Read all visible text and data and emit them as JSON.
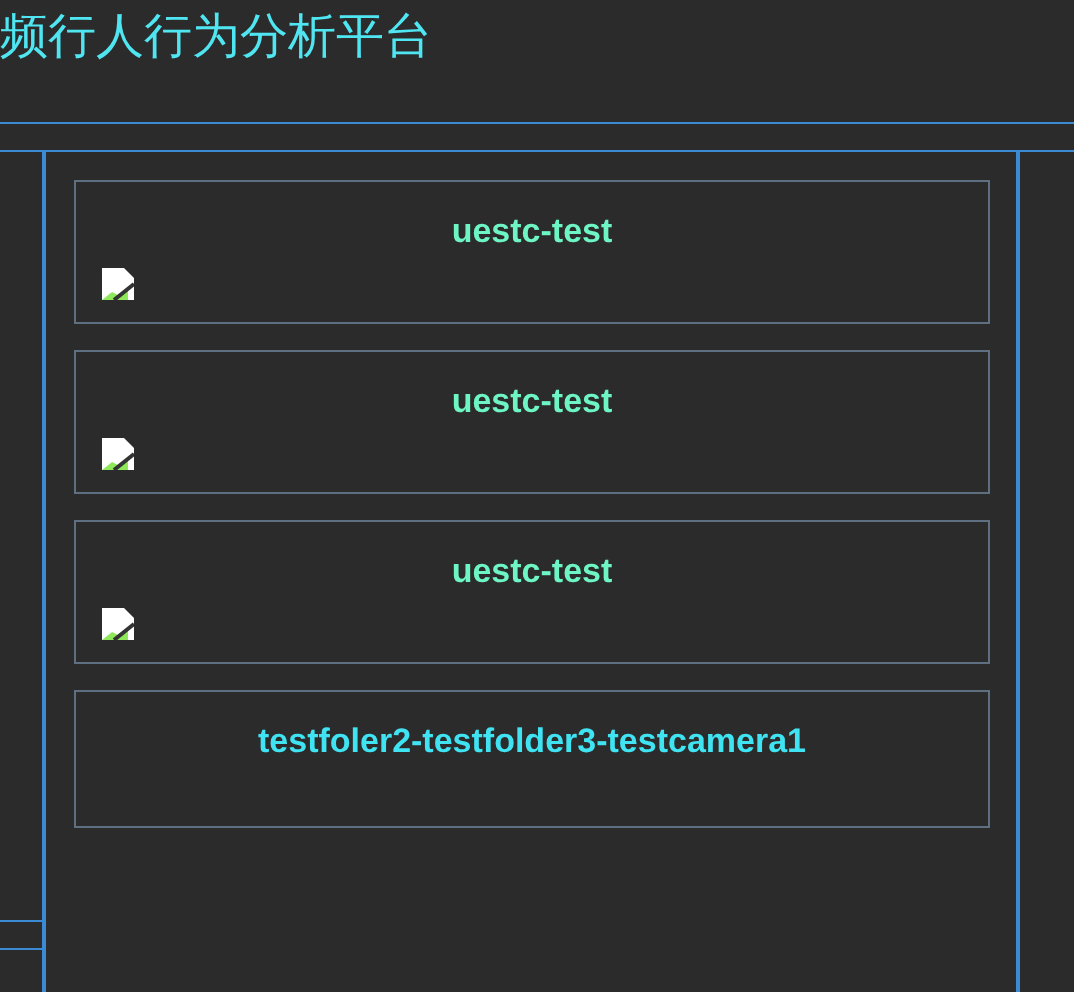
{
  "header": {
    "title": "频行人行为分析平台"
  },
  "cards": [
    {
      "kind": "camera",
      "title": "uestc-test",
      "color": "#6ef5c4"
    },
    {
      "kind": "camera",
      "title": "uestc-test",
      "color": "#6ef5c4"
    },
    {
      "kind": "camera",
      "title": "uestc-test",
      "color": "#6ef5c4"
    },
    {
      "kind": "group",
      "title": "testfoler2-testfolder3-testcamera1",
      "color": "#3fe3f2"
    }
  ]
}
